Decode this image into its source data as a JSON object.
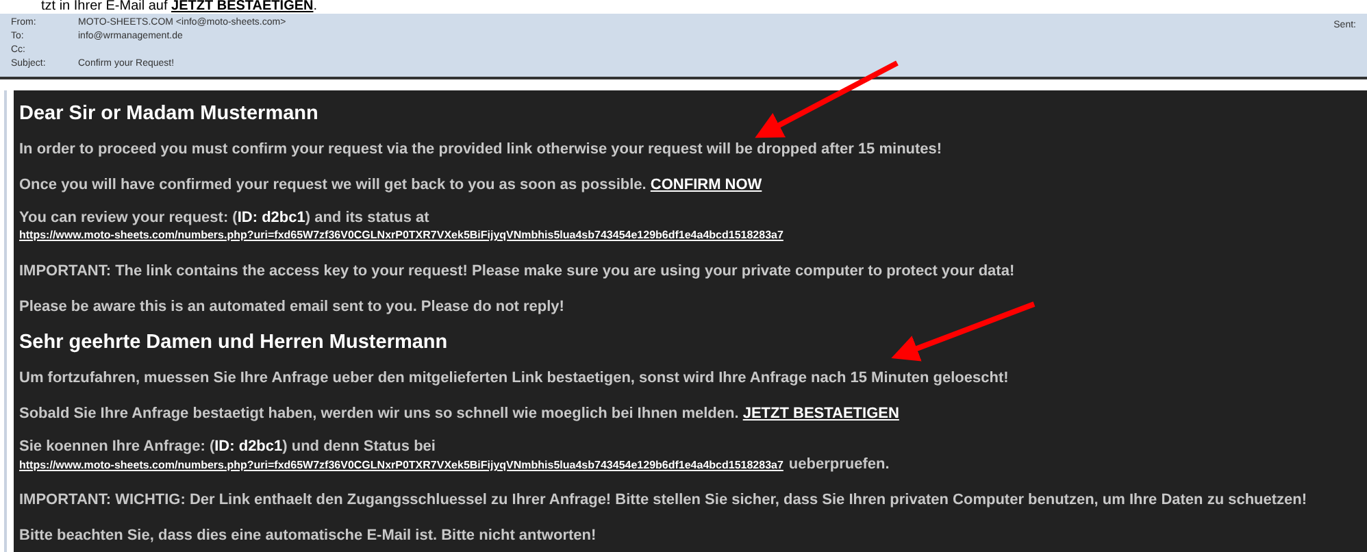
{
  "caption": {
    "text": "tzt in Ihrer E-Mail auf",
    "link": "JETZT BESTAETIGEN",
    "after": "."
  },
  "header": {
    "fields": [
      {
        "label": "From:",
        "value": "MOTO-SHEETS.COM <info@moto-sheets.com>"
      },
      {
        "label": "To:",
        "value": "info@wrmanagement.de"
      },
      {
        "label": "Cc:"
      },
      {
        "label": "Subject:",
        "value": "Confirm your Request!"
      }
    ],
    "sent_label": "Sent:"
  },
  "body": [
    {
      "kind": "heading",
      "text": "Dear Sir or Madam Mustermann"
    },
    {
      "kind": "paragraph",
      "text": "In order to proceed you must confirm your request via the provided link otherwise your request will be dropped after 15 minutes!"
    },
    {
      "kind": "paragraph",
      "text": "Once you will have confirmed your request we will get back to you as soon as possible.",
      "link": "CONFIRM NOW"
    },
    {
      "kind": "review",
      "text": "You can review your request: (**ID: d2bc1**) and its status at",
      "url": "https://www.moto-sheets.com/numbers.php?uri=fxd65W7zf36V0CGLNxrP0TXR7VXek5BiFijyqVNmbhis5lua4sb743454e129b6df1e4a4bcd1518283a7"
    },
    {
      "kind": "paragraph",
      "text": "IMPORTANT: The link contains the access key to your request! Please make sure you are using your private computer to protect your data!"
    },
    {
      "kind": "paragraph",
      "text": "Please be aware this is an automated email sent to you. Please do not reply!"
    },
    {
      "kind": "heading",
      "text": "Sehr geehrte Damen und Herren Mustermann"
    },
    {
      "kind": "paragraph",
      "text": "Um fortzufahren, muessen Sie Ihre Anfrage ueber den mitgelieferten Link bestaetigen, sonst wird Ihre Anfrage nach 15 Minuten geloescht!"
    },
    {
      "kind": "paragraph",
      "text": "Sobald Sie Ihre Anfrage bestaetigt haben, werden wir uns so schnell wie moeglich bei Ihnen melden.",
      "link": "JETZT BESTAETIGEN"
    },
    {
      "kind": "review",
      "text": "Sie koennen Ihre Anfrage: (**ID: d2bc1**) und denn Status bei",
      "url": "https://www.moto-sheets.com/numbers.php?uri=fxd65W7zf36V0CGLNxrP0TXR7VXek5BiFijyqVNmbhis5lua4sb743454e129b6df1e4a4bcd1518283a7",
      "after": "ueberpruefen."
    },
    {
      "kind": "paragraph",
      "text": "IMPORTANT: WICHTIG: Der Link enthaelt den Zugangsschluessel zu Ihrer Anfrage! Bitte stellen Sie sicher, dass Sie Ihren privaten Computer benutzen, um Ihre Daten zu schuetzen!"
    },
    {
      "kind": "paragraph",
      "text": "Bitte beachten Sie, dass dies eine automatische E-Mail ist. Bitte nicht antworten!"
    }
  ]
}
